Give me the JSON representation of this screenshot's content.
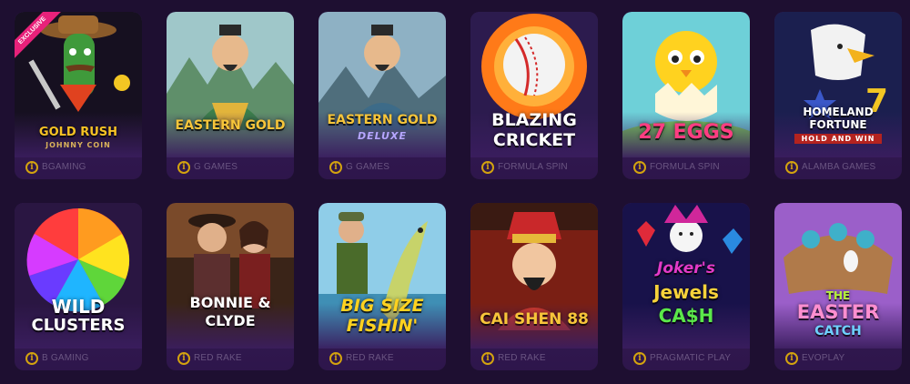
{
  "games": [
    {
      "title": "GOLD RUSH",
      "subtitle": "JOHNNY COIN",
      "provider": "BGAMING",
      "badge": "EXCLUSIVE"
    },
    {
      "title": "EASTERN GOLD",
      "provider": "G GAMES"
    },
    {
      "title": "EASTERN GOLD",
      "subtitle": "DELUXE",
      "provider": "G GAMES"
    },
    {
      "title": "BLAZING",
      "title2": "CRICKET",
      "provider": "FORMULA SPIN"
    },
    {
      "title": "27 EGGS",
      "provider": "FORMULA SPIN"
    },
    {
      "title": "HOMELAND",
      "title2": "FORTUNE",
      "subtitle": "HOLD AND WIN",
      "provider": "ALAMBA GAMES"
    },
    {
      "title": "WILD",
      "title2": "CLUSTERS",
      "provider": "B GAMING"
    },
    {
      "title": "BONNIE &",
      "title2": "CLYDE",
      "provider": "RED RAKE"
    },
    {
      "title": "BIG SIZE",
      "title2": "FISHIN'",
      "provider": "RED RAKE"
    },
    {
      "title": "CAI SHEN 88",
      "provider": "RED RAKE"
    },
    {
      "title": "Joker's",
      "title2": "Jewels",
      "title3": "CA$H",
      "provider": "PRAGMATIC PLAY"
    },
    {
      "title": "THE",
      "title2": "EASTER",
      "title3": "CATCH",
      "provider": "EVOPLAY"
    }
  ],
  "info_glyph": "i",
  "icons": {
    "info": "info-circle-icon"
  },
  "colors": {
    "background": "#1e0f31",
    "card": "#3a1d5e",
    "accent": "#d3a30f",
    "badge": "#e8217a",
    "provider_text": "#6a5582"
  }
}
